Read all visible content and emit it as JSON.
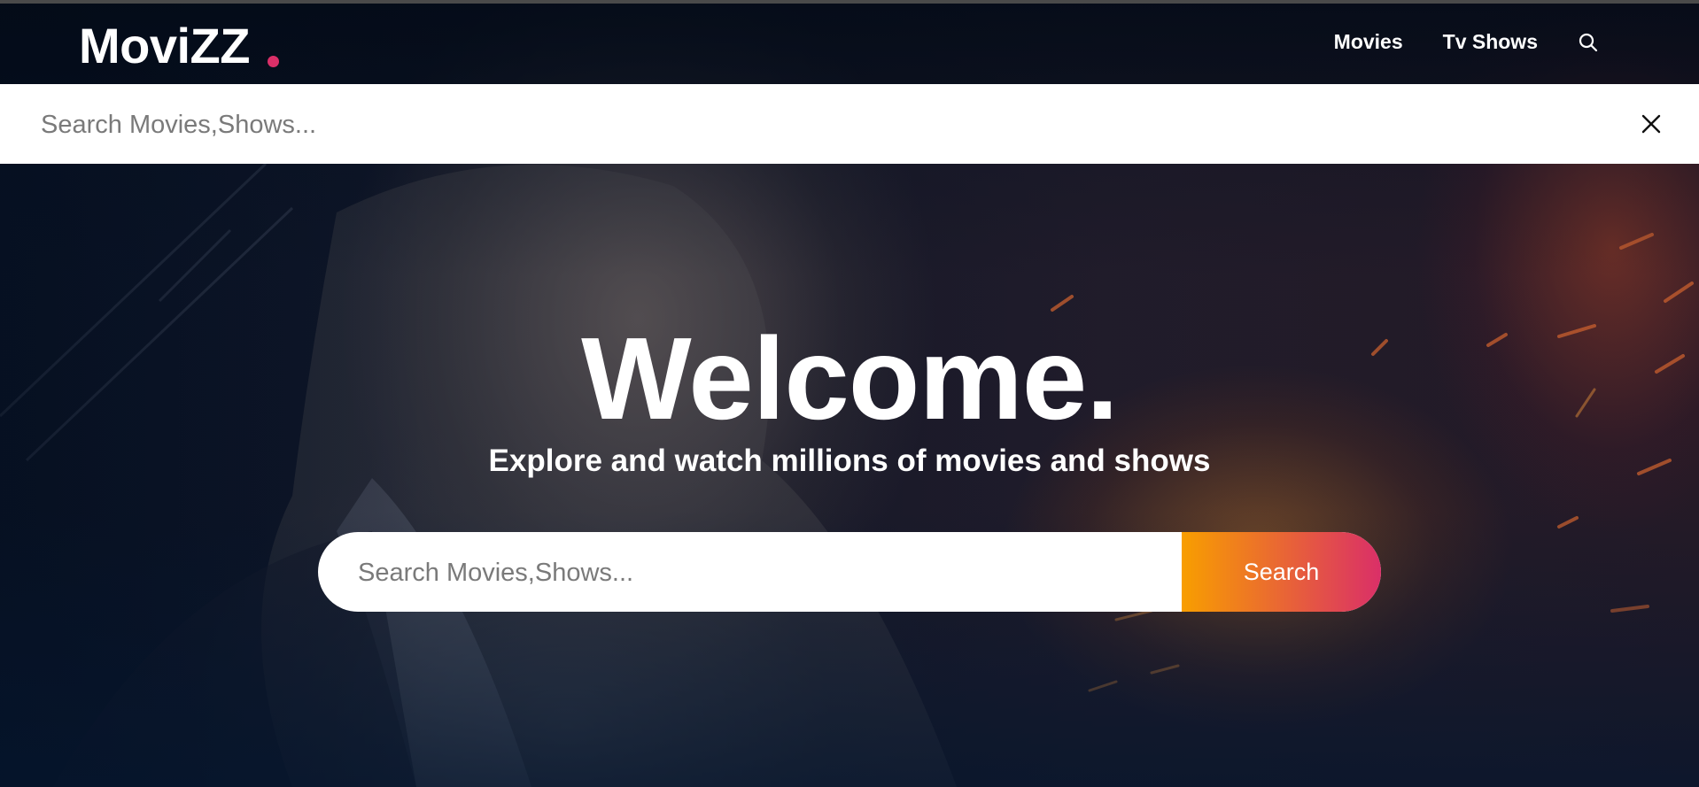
{
  "header": {
    "logo": "MoviZZ",
    "nav": [
      {
        "label": "Movies"
      },
      {
        "label": "Tv Shows"
      }
    ],
    "search_icon": "search-icon"
  },
  "search_overlay": {
    "placeholder": "Search Movies,Shows...",
    "value": "",
    "close_icon": "close-icon"
  },
  "hero": {
    "title": "Welcome.",
    "subtitle": "Explore and watch millions of movies and shows",
    "search_placeholder": "Search Movies,Shows...",
    "search_value": "",
    "search_button": "Search"
  },
  "colors": {
    "accent_pink": "#da2f68",
    "accent_orange": "#f89e00",
    "background": "#04152d",
    "text": "#ffffff"
  }
}
